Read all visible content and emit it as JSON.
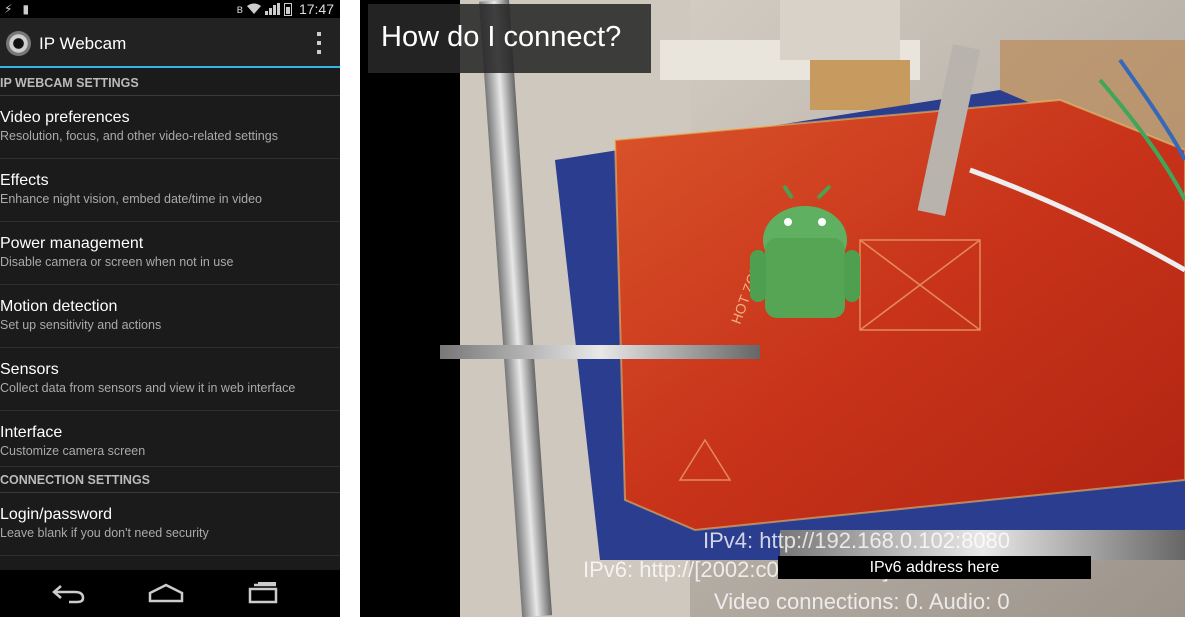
{
  "status_bar": {
    "time": "17:47",
    "left_icons": [
      "usb-icon",
      "sim-icon"
    ],
    "right_icons": [
      "bluetooth-icon",
      "wifi-icon",
      "signal-icon",
      "battery-icon"
    ]
  },
  "action_bar": {
    "title": "IP Webcam",
    "logo_icon": "camera-lens-icon",
    "menu_icon": "overflow-menu-icon"
  },
  "sections": [
    {
      "header": "IP WEBCAM SETTINGS",
      "items": [
        {
          "title": "Video preferences",
          "summary": "Resolution, focus, and other video-related settings"
        },
        {
          "title": "Effects",
          "summary": "Enhance night vision, embed date/time in video"
        },
        {
          "title": "Power management",
          "summary": "Disable camera or screen when not in use"
        },
        {
          "title": "Motion detection",
          "summary": "Set up sensitivity and actions"
        },
        {
          "title": "Sensors",
          "summary": "Collect data from sensors and view it in web interface"
        },
        {
          "title": "Interface",
          "summary": "Customize camera screen"
        }
      ]
    },
    {
      "header": "CONNECTION SETTINGS",
      "items": [
        {
          "title": "Login/password",
          "summary": "Leave blank if you don't need security"
        }
      ]
    }
  ],
  "nav_bar": {
    "icons": [
      "back-icon",
      "home-icon",
      "recent-apps-icon"
    ]
  },
  "camera": {
    "connect_button": "How do I connect?",
    "ipv4": "IPv4: http://192.168.0.102:8080",
    "ipv6": "IPv6: http://[2002:c0a8:6602::1]:8080",
    "connections": "Video connections: 0. Audio: 0",
    "ipv6_overlay": "IPv6 address here"
  },
  "colors": {
    "accent": "#33b5e5",
    "background": "#1b1b1b",
    "heatbed": "#c8331a"
  }
}
